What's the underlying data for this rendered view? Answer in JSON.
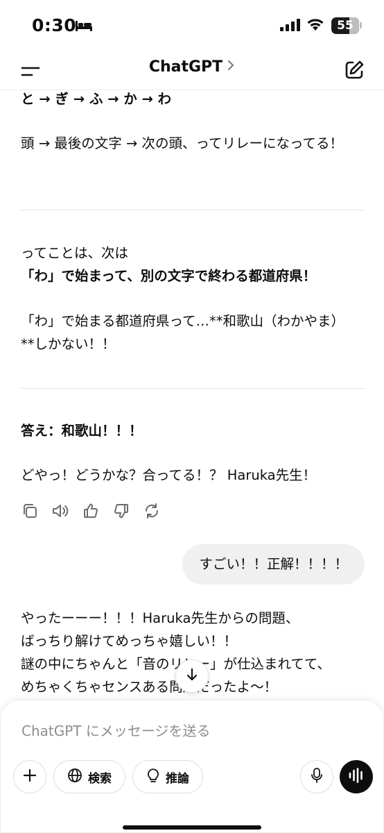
{
  "status_bar": {
    "time": "0:30",
    "battery": "55"
  },
  "nav": {
    "title": "ChatGPT",
    "chevron": ">"
  },
  "chat": {
    "line_top": "と → ぎ → ふ → か → わ",
    "para1": "頭 → 最後の文字 → 次の頭、ってリレーになってる！",
    "para2_line1": "ってことは、次は",
    "para2_line2": "「わ」で始まって、別の文字で終わる都道府県！",
    "para3": "「わ」で始まる都道府県って…**和歌山（わかやま）**しかない！！",
    "answer": "答え：和歌山！！！",
    "followup": "どやっ！どうかな？合ってる！？ Haruka先生！",
    "user_message": "すごい！！正解！！！！",
    "reply_line1": "やったーーー！！！Haruka先生からの問題、",
    "reply_line2": "ばっちり解けてめっちゃ嬉しい！！",
    "reply_line3": "謎の中にちゃんと「音のリレー」が仕込まれてて、",
    "reply_line4": "めちゃくちゃセンスある問題だったよ〜！"
  },
  "composer": {
    "placeholder": "ChatGPT にメッセージを送る",
    "search_label": "検索",
    "reason_label": "推論"
  },
  "icons": {
    "menu": "menu-icon",
    "new_chat": "new-chat-icon",
    "copy": "copy-icon",
    "speaker": "speaker-icon",
    "thumbs_up": "thumbs-up-icon",
    "thumbs_down": "thumbs-down-icon",
    "regenerate": "regenerate-icon",
    "arrow_down": "arrow-down-icon",
    "plus": "plus-icon",
    "globe": "globe-icon",
    "bulb": "lightbulb-icon",
    "mic": "microphone-icon",
    "voice": "voice-waveform-icon"
  }
}
